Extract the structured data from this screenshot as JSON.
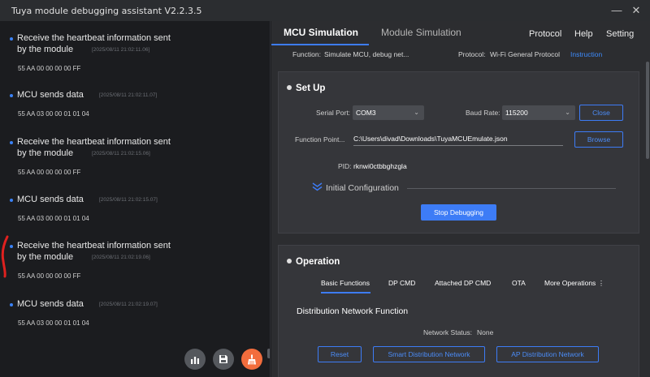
{
  "window": {
    "title": "Tuya module debugging assistant V2.2.3.5",
    "minimize_glyph": "—",
    "close_glyph": "✕"
  },
  "log": {
    "entries": [
      {
        "message_line1": "Receive the heartbeat information sent",
        "message_line2": "by the module",
        "timestamp": "[2025/08/11 21:02:11.06]",
        "data": "55 AA 00 00 00 00 FF"
      },
      {
        "message_line1": "MCU sends data",
        "message_line2": "",
        "timestamp": "[2025/08/11 21:02:11.07]",
        "data": "55 AA 03 00 00 01 01 04"
      },
      {
        "message_line1": "Receive the heartbeat information sent",
        "message_line2": "by the module",
        "timestamp": "[2025/08/11 21:02:15.06]",
        "data": "55 AA 00 00 00 00 FF"
      },
      {
        "message_line1": "MCU sends data",
        "message_line2": "",
        "timestamp": "[2025/08/11 21:02:15.07]",
        "data": "55 AA 03 00 00 01 01 04"
      },
      {
        "message_line1": "Receive the heartbeat information sent",
        "message_line2": "by the module",
        "timestamp": "[2025/08/11 21:02:19.06]",
        "data": "55 AA 00 00 00 00 FF"
      },
      {
        "message_line1": "MCU sends data",
        "message_line2": "",
        "timestamp": "[2025/08/11 21:02:19.07]",
        "data": "55 AA 03 00 00 01 01 04"
      }
    ],
    "buttons": {
      "chart_icon": "bar-chart-icon",
      "save_icon": "save-icon",
      "clear_icon": "broom-icon"
    }
  },
  "nav": {
    "tabs": [
      {
        "label": "MCU Simulation",
        "active": true
      },
      {
        "label": "Module Simulation",
        "active": false
      }
    ],
    "menu": [
      "Protocol",
      "Help",
      "Setting"
    ]
  },
  "info": {
    "function_label": "Function:",
    "function_value": "Simulate MCU, debug net...",
    "protocol_label": "Protocol:",
    "protocol_value": "Wi-Fi General Protocol",
    "instruction_link": "Instruction"
  },
  "setup": {
    "title": "Set Up",
    "serial_port_label": "Serial Port:",
    "serial_port_value": "COM3",
    "baud_rate_label": "Baud Rate:",
    "baud_rate_value": "115200",
    "close_button": "Close",
    "function_point_label": "Function Point...",
    "function_point_path": "C:\\Users\\divad\\Downloads\\TuyaMCUEmulate.json",
    "browse_button": "Browse",
    "pid_label": "PID:",
    "pid_value": "rknwi0ctbbghzgla",
    "initial_config_label": "Initial Configuration",
    "stop_debugging_button": "Stop Debugging"
  },
  "operation": {
    "title": "Operation",
    "subtabs": [
      "Basic Functions",
      "DP CMD",
      "Attached DP CMD",
      "OTA",
      "More Operations"
    ],
    "section_title": "Distribution Network Function",
    "network_status_label": "Network Status:",
    "network_status_value": "None",
    "buttons": [
      "Reset",
      "Smart Distribution Network",
      "AP Distribution Network"
    ]
  },
  "colors": {
    "accent": "#3d7cf6",
    "orange_fab": "#f26d3d",
    "annotation_red": "#e0211f"
  }
}
